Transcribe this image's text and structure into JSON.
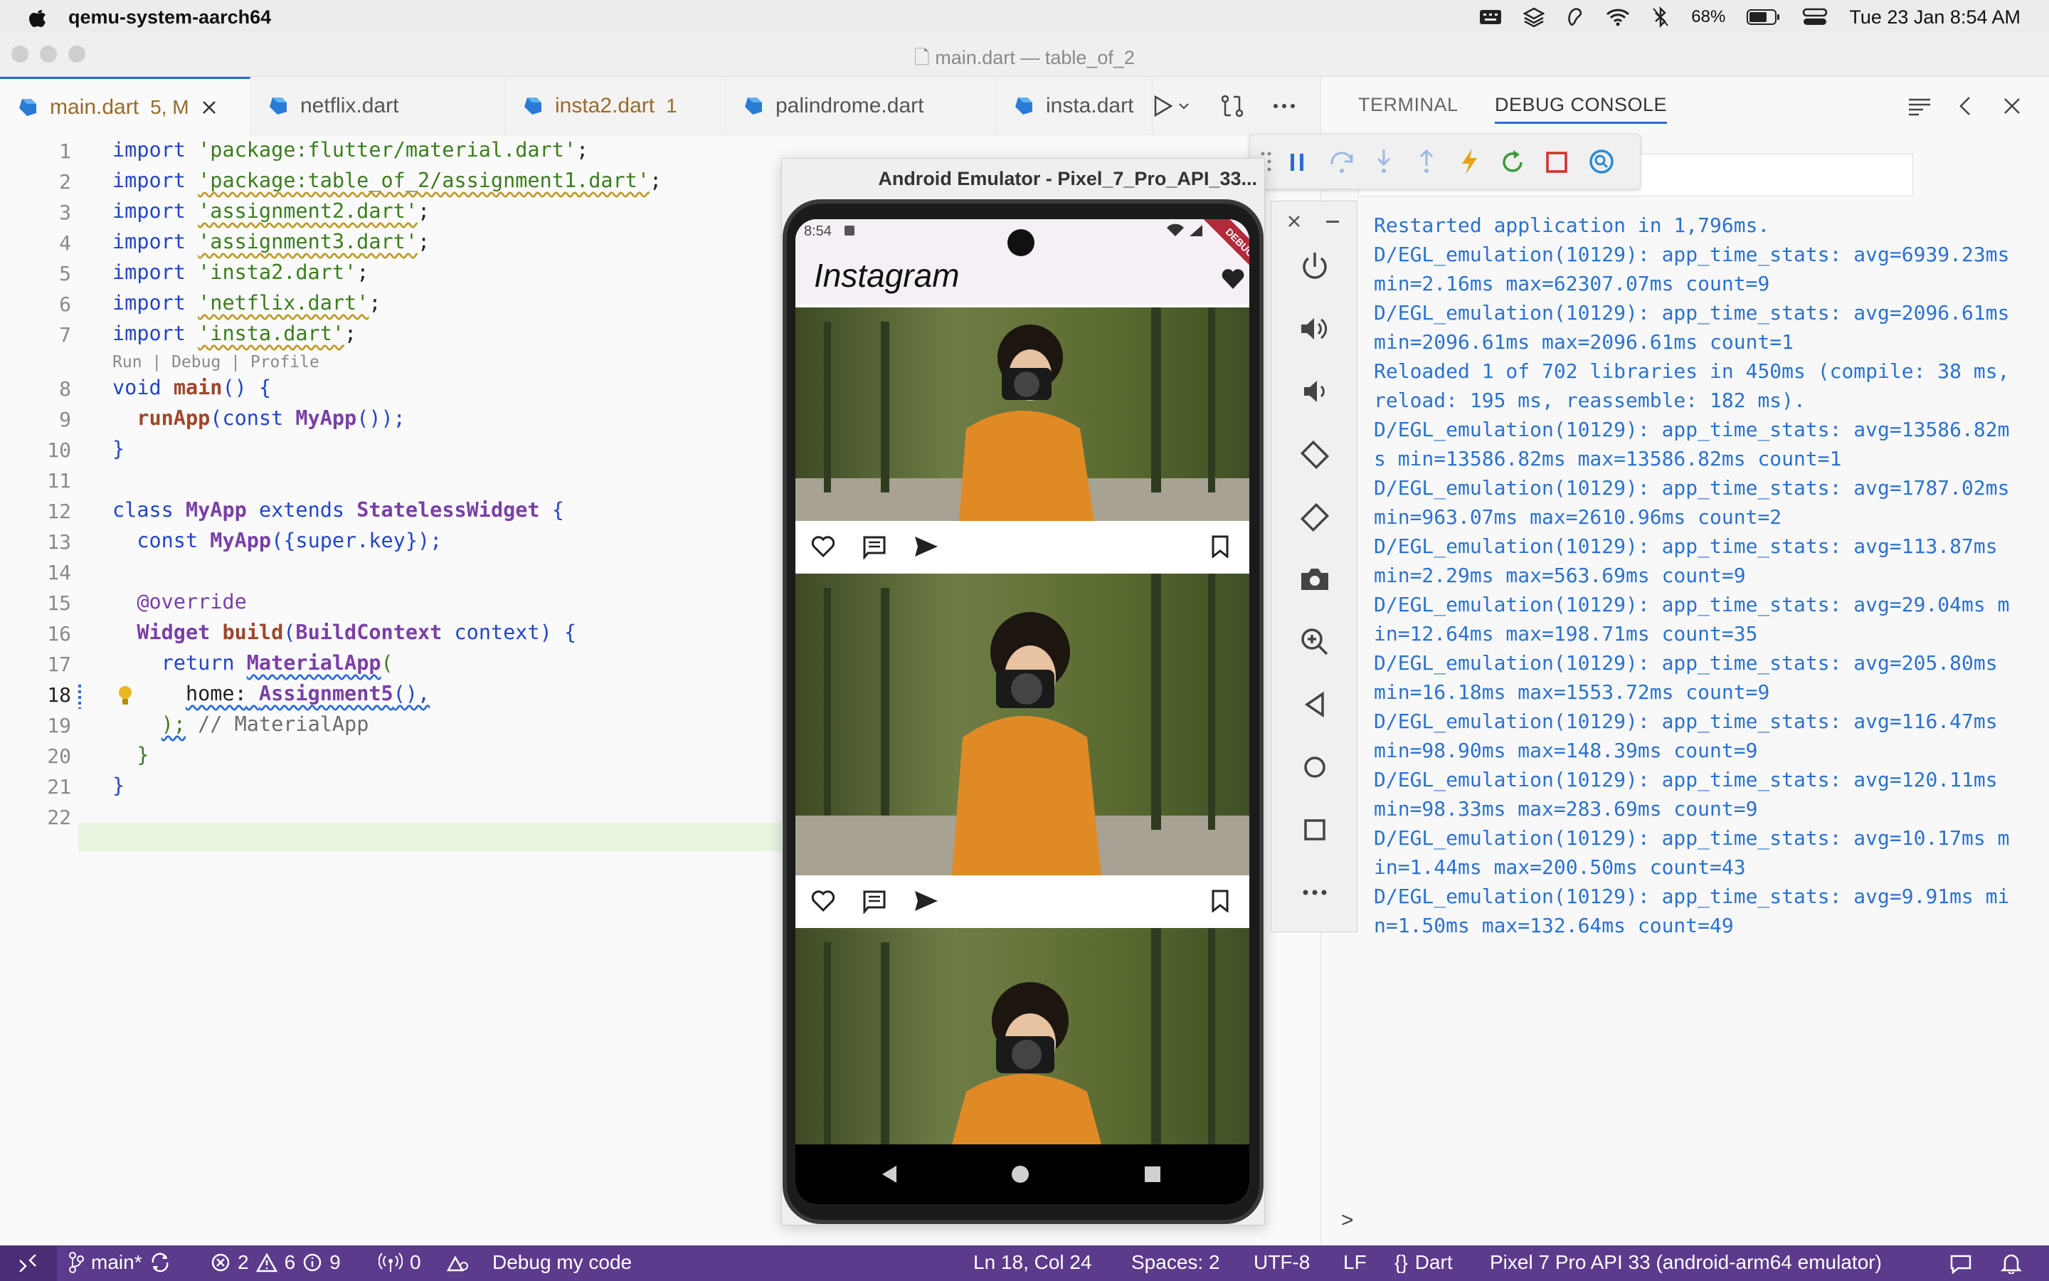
{
  "menubar": {
    "app_name": "qemu-system-aarch64",
    "battery": "68%",
    "datetime": "Tue 23 Jan  8:54 AM",
    "icons": [
      "apple-icon",
      "keyboard-icon",
      "layers-icon",
      "app-icon",
      "wifi-icon",
      "bluetooth-icon",
      "battery-icon",
      "control-center-icon"
    ]
  },
  "window": {
    "title": "main.dart — table_of_2"
  },
  "tabs": [
    {
      "label": "main.dart",
      "badge": "5, M",
      "active": true
    },
    {
      "label": "netflix.dart",
      "badge": ""
    },
    {
      "label": "insta2.dart",
      "badge": "1"
    },
    {
      "label": "palindrome.dart",
      "badge": ""
    },
    {
      "label": "insta.dart",
      "badge": ""
    }
  ],
  "editor": {
    "line_numbers": [
      "1",
      "2",
      "3",
      "4",
      "5",
      "6",
      "7",
      "8",
      "9",
      "10",
      "11",
      "12",
      "13",
      "14",
      "15",
      "16",
      "17",
      "18",
      "19",
      "20",
      "21",
      "22"
    ],
    "lines": {
      "l1_kw": "import",
      "l1_str": "'package:flutter/material.dart'",
      "semi": ";",
      "l2_str": "'package:table_of_2/assignment1.dart'",
      "l3_str": "'assignment2.dart'",
      "l4_str": "'assignment3.dart'",
      "l5_str": "'insta2.dart'",
      "l6_str": "'netflix.dart'",
      "l7_str": "'insta.dart'",
      "codelens": "Run | Debug | Profile",
      "l8_void": "void",
      "l8_main": "main",
      "l8_rest": "() {",
      "l9_runapp": "runApp",
      "l9_const": "(const ",
      "l9_myapp": "MyApp",
      "l9_rest": "());",
      "l10": "}",
      "l12_class": "class",
      "l12_myapp": "MyApp",
      "l12_extends": "extends",
      "l12_sw": "StatelessWidget",
      "l12_brace": "{",
      "l13_const": "const",
      "l13_myapp": "MyApp",
      "l13_rest": "({super.key});",
      "l15": "@override",
      "l16_widget": "Widget",
      "l16_build": "build",
      "l16_bc": "BuildContext",
      "l16_rest": "context) {",
      "l17_return": "return",
      "l17_mat": "MaterialApp",
      "l17_paren": "(",
      "l18_home": "home:",
      "l18_a5": "Assignment5",
      "l18_rest": "(),",
      "l19_close": ");",
      "l19_comment": "// MaterialApp",
      "l20": "}",
      "l21": "}"
    }
  },
  "panel": {
    "tab_terminal": "TERMINAL",
    "tab_debug": "DEBUG CONSOLE",
    "logs": [
      "Restarted application in 1,796ms.",
      "D/EGL_emulation(10129): app_time_stats: avg=6939.23ms",
      "min=2.16ms max=62307.07ms count=9",
      "D/EGL_emulation(10129): app_time_stats: avg=2096.61ms",
      "min=2096.61ms max=2096.61ms count=1",
      "Reloaded 1 of 702 libraries in 450ms (compile: 38 ms,",
      "reload: 195 ms, reassemble: 182 ms).",
      "D/EGL_emulation(10129): app_time_stats: avg=13586.82m",
      "s min=13586.82ms max=13586.82ms count=1",
      "D/EGL_emulation(10129): app_time_stats: avg=1787.02ms",
      "min=963.07ms max=2610.96ms count=2",
      "D/EGL_emulation(10129): app_time_stats: avg=113.87ms",
      "min=2.29ms max=563.69ms count=9",
      "D/EGL_emulation(10129): app_time_stats: avg=29.04ms m",
      "in=12.64ms max=198.71ms count=35",
      "D/EGL_emulation(10129): app_time_stats: avg=205.80ms",
      "min=16.18ms max=1553.72ms count=9",
      "D/EGL_emulation(10129): app_time_stats: avg=116.47ms",
      "min=98.90ms max=148.39ms count=9",
      "D/EGL_emulation(10129): app_time_stats: avg=120.11ms",
      "min=98.33ms max=283.69ms count=9",
      "D/EGL_emulation(10129): app_time_stats: avg=10.17ms m",
      "in=1.44ms max=200.50ms count=43",
      "D/EGL_emulation(10129): app_time_stats: avg=9.91ms mi",
      "n=1.50ms max=132.64ms count=49"
    ],
    "prompt": ">"
  },
  "emulator": {
    "title": "Android Emulator - Pixel_7_Pro_API_33...",
    "status_time": "8:54",
    "debug_banner": "DEBUG",
    "app_title": "Instagram"
  },
  "statusbar": {
    "branch": "main*",
    "errors": "2",
    "warnings": "6",
    "infos": "9",
    "ports": "0",
    "debug": "Debug my code",
    "position": "Ln 18, Col 24",
    "spaces": "Spaces: 2",
    "encoding": "UTF-8",
    "eol": "LF",
    "language": "Dart",
    "device": "Pixel 7 Pro API 33 (android-arm64 emulator)"
  },
  "colors": {
    "accent": "#2a6bd6",
    "statusbar": "#5c3a8c",
    "log": "#2a72d0"
  }
}
